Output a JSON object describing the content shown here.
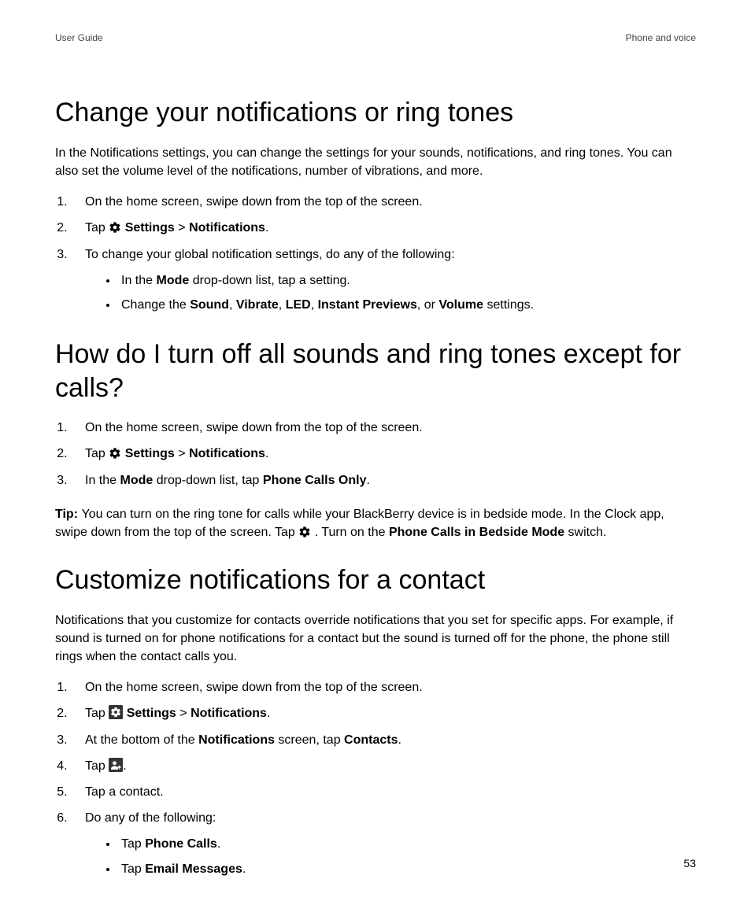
{
  "header": {
    "left": "User Guide",
    "right": "Phone and voice"
  },
  "page_number": "53",
  "s1": {
    "title": "Change your notifications or ring tones",
    "intro": "In the Notifications settings, you can change the settings for your sounds, notifications, and ring tones. You can also set the volume level of the notifications, number of vibrations, and more.",
    "step1": "On the home screen, swipe down from the top of the screen.",
    "step2_tap": "Tap ",
    "step2_settings": "Settings",
    "gt": " > ",
    "step2_notifications": "Notifications",
    "period": ".",
    "step3": "To change your global notification settings, do any of the following:",
    "b1_a": "In the ",
    "b1_mode": "Mode",
    "b1_b": " drop-down list, tap a setting.",
    "b2_a": "Change the ",
    "b2_sound": "Sound",
    "comma": ", ",
    "b2_vibrate": "Vibrate",
    "b2_led": "LED",
    "b2_instant": "Instant Previews",
    "b2_or": ", or ",
    "b2_volume": "Volume",
    "b2_end": " settings."
  },
  "s2": {
    "title": "How do I turn off all sounds and ring tones except for calls?",
    "step1": "On the home screen, swipe down from the top of the screen.",
    "step2_tap": "Tap ",
    "step2_settings": "Settings",
    "gt": " > ",
    "step2_notifications": "Notifications",
    "period": ".",
    "step3_a": "In the ",
    "step3_mode": "Mode",
    "step3_b": " drop-down list, tap ",
    "step3_pco": "Phone Calls Only",
    "tip_label": "Tip: ",
    "tip_a": "You can turn on the ring tone for calls while your BlackBerry device is in bedside mode. In the Clock app, swipe down from the top of the screen. Tap ",
    "tip_b": " . Turn on the ",
    "tip_switch": "Phone Calls in Bedside Mode",
    "tip_c": " switch."
  },
  "s3": {
    "title": "Customize notifications for a contact",
    "intro": "Notifications that you customize for contacts override notifications that you set for specific apps. For example, if sound is turned on for phone notifications for a contact but the sound is turned off for the phone, the phone still rings when the contact calls you.",
    "step1": "On the home screen, swipe down from the top of the screen.",
    "step2_tap": "Tap ",
    "step2_settings": "Settings",
    "gt": " > ",
    "step2_notifications": "Notifications",
    "period": ".",
    "step3_a": "At the bottom of the ",
    "step3_notif": "Notifications",
    "step3_b": " screen, tap ",
    "step3_contacts": "Contacts",
    "step4_tap": "Tap ",
    "step5": "Tap a contact.",
    "step6": "Do any of the following:",
    "b1_tap": "Tap ",
    "b1_pc": "Phone Calls",
    "b2_tap": "Tap ",
    "b2_em": "Email Messages"
  }
}
